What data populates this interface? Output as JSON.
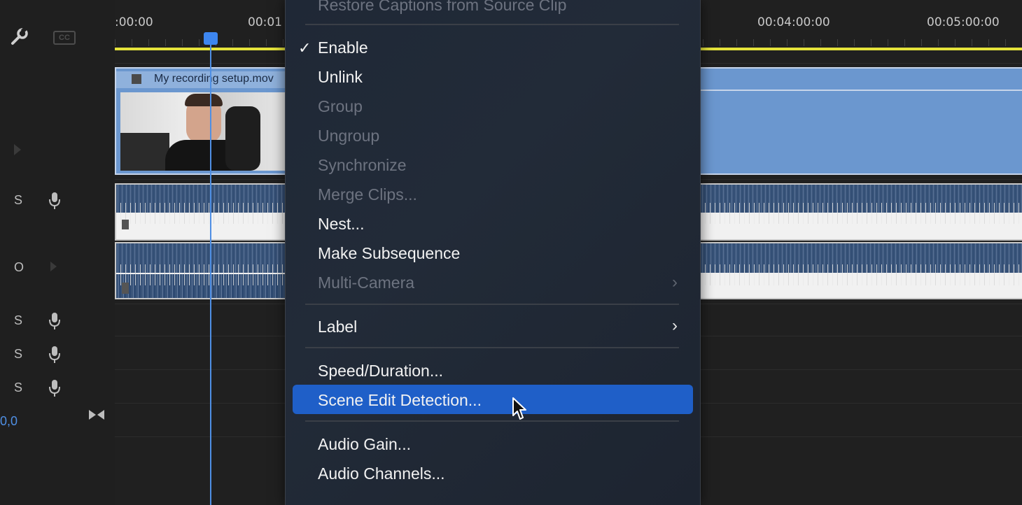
{
  "left_panel": {
    "track_labels": [
      "S",
      "O",
      "S",
      "S",
      "S"
    ],
    "value_text": "0,0"
  },
  "timeline": {
    "timecodes": [
      ":00:00",
      "00:01",
      "00:04:00:00",
      "00:05:00:00"
    ],
    "clip_title": "My recording setup.mov"
  },
  "context_menu": {
    "top_item": "Restore Captions from Source Clip",
    "items": [
      {
        "label": "Enable",
        "enabled": true,
        "checked": true
      },
      {
        "label": "Unlink",
        "enabled": true
      },
      {
        "label": "Group",
        "enabled": false
      },
      {
        "label": "Ungroup",
        "enabled": false
      },
      {
        "label": "Synchronize",
        "enabled": false
      },
      {
        "label": "Merge Clips...",
        "enabled": false
      },
      {
        "label": "Nest...",
        "enabled": true
      },
      {
        "label": "Make Subsequence",
        "enabled": true
      },
      {
        "label": "Multi-Camera",
        "enabled": false,
        "submenu": true
      },
      {
        "label": "Label",
        "enabled": true,
        "submenu": true
      },
      {
        "label": "Speed/Duration...",
        "enabled": true
      },
      {
        "label": "Scene Edit Detection...",
        "enabled": true,
        "highlighted": true
      },
      {
        "label": "Audio Gain...",
        "enabled": true
      },
      {
        "label": "Audio Channels...",
        "enabled": true
      }
    ]
  },
  "colors": {
    "menu_highlight": "#1f5fc8",
    "playhead": "#3d86f0",
    "work_area_bar": "#e5e33b",
    "video_clip": "#6b97cf"
  },
  "icons": {
    "wrench": "wrench-icon",
    "captions": "cc-icon",
    "mic": "microphone-icon",
    "play": "play-triangle-icon",
    "snap": "snap-icon"
  }
}
